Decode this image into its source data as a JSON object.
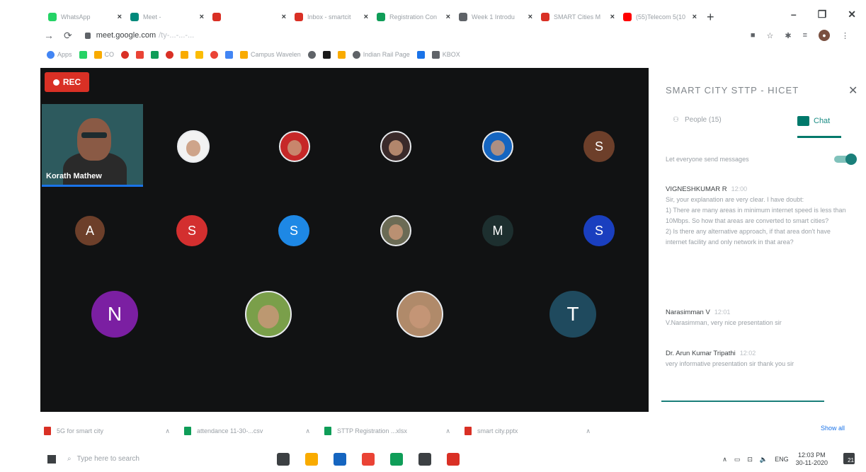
{
  "browser": {
    "tabs": [
      {
        "title": "WhatsApp",
        "favicon_color": "#25d366"
      },
      {
        "title": "Meet -",
        "favicon_color": "#00897b"
      },
      {
        "title": "",
        "favicon_color": "#d93025"
      },
      {
        "title": "Inbox - smartcit",
        "favicon_color": "#d93025"
      },
      {
        "title": "Registration Con",
        "favicon_color": "#0f9d58"
      },
      {
        "title": "Week 1 Introdu",
        "favicon_color": "#5f6368"
      },
      {
        "title": "SMART Cities M",
        "favicon_color": "#d93025"
      },
      {
        "title": "(55)Telecom 5(10",
        "favicon_color": "#ff0000"
      }
    ],
    "new_tab_glyph": "+",
    "window_controls": [
      "–",
      "❐",
      "✕"
    ],
    "address": {
      "url": "meet.google.com",
      "url_suffix": "/ty-...-...-..."
    },
    "bookmarks": [
      {
        "label": "Apps",
        "color": "#4285f4"
      },
      {
        "label": "",
        "color": "#25d366"
      },
      {
        "label": "CO",
        "color": "#f9ab00"
      },
      {
        "label": "",
        "color": "#d93025"
      },
      {
        "label": "",
        "color": "#ea4335"
      },
      {
        "label": "",
        "color": "#0f9d58"
      },
      {
        "label": "",
        "color": "#d93025"
      },
      {
        "label": "",
        "color": "#f9ab00"
      },
      {
        "label": "",
        "color": "#fbbc04"
      },
      {
        "label": "",
        "color": "#ea4335"
      },
      {
        "label": "",
        "color": "#4285f4"
      },
      {
        "label": "Campus Wavelen",
        "color": "#f9ab00"
      },
      {
        "label": "",
        "color": "#5f6368"
      },
      {
        "label": "",
        "color": "#1a1a1a"
      },
      {
        "label": "",
        "color": "#f9ab00"
      },
      {
        "label": "Indian Rail Page",
        "color": "#5f6368"
      },
      {
        "label": "",
        "color": "#1a73e8"
      },
      {
        "label": "KBOX",
        "color": "#5f6368"
      }
    ]
  },
  "meet": {
    "rec_label": "REC",
    "featured_name": "Korath Mathew",
    "participants": [
      {
        "kind": "photo",
        "color": "#f2f2f2",
        "label": ""
      },
      {
        "kind": "photo",
        "color": "#c62828",
        "label": ""
      },
      {
        "kind": "photo",
        "color": "#3a2a2a",
        "label": ""
      },
      {
        "kind": "photo",
        "color": "#1565c0",
        "label": ""
      },
      {
        "kind": "letter",
        "color": "#6d3f2a",
        "label": "S"
      },
      {
        "kind": "letter",
        "color": "#6d3f2a",
        "label": "A"
      },
      {
        "kind": "letter",
        "color": "#d32f2f",
        "label": "S"
      },
      {
        "kind": "letter",
        "color": "#1e88e5",
        "label": "S"
      },
      {
        "kind": "photo",
        "color": "#6b6b55",
        "label": ""
      },
      {
        "kind": "letter",
        "color": "#1d2f2f",
        "label": "M"
      },
      {
        "kind": "letter",
        "color": "#1a3fbf",
        "label": "S"
      },
      {
        "kind": "letter",
        "color": "#7b1fa2",
        "label": "N"
      },
      {
        "kind": "photo",
        "color": "#7a9f4a",
        "label": ""
      },
      {
        "kind": "photo",
        "color": "#b08a6a",
        "label": ""
      },
      {
        "kind": "letter",
        "color": "#1f4a5e",
        "label": "T"
      }
    ]
  },
  "panel": {
    "title": "SMART CITY STTP - HICET",
    "close_glyph": "✕",
    "tab_people": "People (15)",
    "tab_chat": "Chat",
    "toggle_text": "Let everyone send messages",
    "toggle_on": true,
    "messages": [
      {
        "sender": "VIGNESHKUMAR R",
        "time": "12:00",
        "text": "Sir, your explanation are very clear. I have doubt:\n1) There are many areas in minimum internet speed is less than 10Mbps. So how that areas are converted to smart cities?\n2) Is there any alternative approach, if that area don't have internet facility and only network in that area?"
      },
      {
        "sender": "Narasimman V",
        "time": "12:01",
        "text": "V.Narasimman, very nice presentation sir"
      },
      {
        "sender": "Dr. Arun Kumar Tripathi",
        "time": "12:02",
        "text": "very informative presentation sir thank you sir"
      }
    ]
  },
  "downloads": {
    "items": [
      {
        "name": "5G for smart city",
        "color": "#d93025"
      },
      {
        "name": "attendance 11-30-...csv",
        "color": "#0f9d58"
      },
      {
        "name": "STTP Registration ...xlsx",
        "color": "#0f9d58"
      },
      {
        "name": "smart city.pptx",
        "color": "#d93025"
      }
    ],
    "show_all": "Show all"
  },
  "taskbar": {
    "search_placeholder": "Type here to search",
    "apps": [
      {
        "color": "#3c4043"
      },
      {
        "color": "#f9ab00"
      },
      {
        "color": "#1565c0"
      },
      {
        "color": "#ea4335"
      },
      {
        "color": "#0f9d58"
      },
      {
        "color": "#3c4043"
      },
      {
        "color": "#d93025"
      }
    ],
    "tray": {
      "lang": "ENG",
      "time": "12:03 PM",
      "date": "30-11-2020"
    },
    "notifications": "21"
  }
}
